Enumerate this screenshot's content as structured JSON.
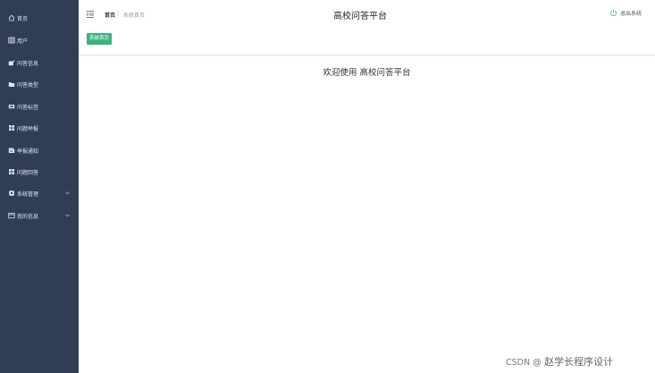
{
  "sidebar": {
    "items": [
      {
        "label": "首页",
        "icon": "home-icon",
        "expandable": false
      },
      {
        "label": "用户",
        "icon": "grid-icon",
        "expandable": false
      },
      {
        "label": "问答信息",
        "icon": "edit-icon",
        "expandable": false
      },
      {
        "label": "问答类型",
        "icon": "folder-icon",
        "expandable": false
      },
      {
        "label": "问答标签",
        "icon": "tag-icon",
        "expandable": false
      },
      {
        "label": "问题举报",
        "icon": "apps-icon",
        "expandable": false
      },
      {
        "label": "举报通知",
        "icon": "notice-icon",
        "expandable": false
      },
      {
        "label": "问题回答",
        "icon": "apps-icon",
        "expandable": false
      },
      {
        "label": "系统管理",
        "icon": "settings-icon",
        "expandable": true
      },
      {
        "label": "我的信息",
        "icon": "profile-icon",
        "expandable": true
      }
    ]
  },
  "header": {
    "breadcrumb": {
      "home": "首页",
      "separator": "/",
      "current": "系统首页"
    },
    "title": "高校问答平台",
    "logout_label": "退出系统"
  },
  "tabs": [
    {
      "label": "系统首页"
    }
  ],
  "main": {
    "welcome": "欢迎使用 高校问答平台"
  },
  "watermark": {
    "prefix": "CSDN @",
    "author": "赵学长程序设计"
  },
  "colors": {
    "sidebar_bg": "#2f3e55",
    "accent": "#3cb27e",
    "text": "#333333"
  }
}
